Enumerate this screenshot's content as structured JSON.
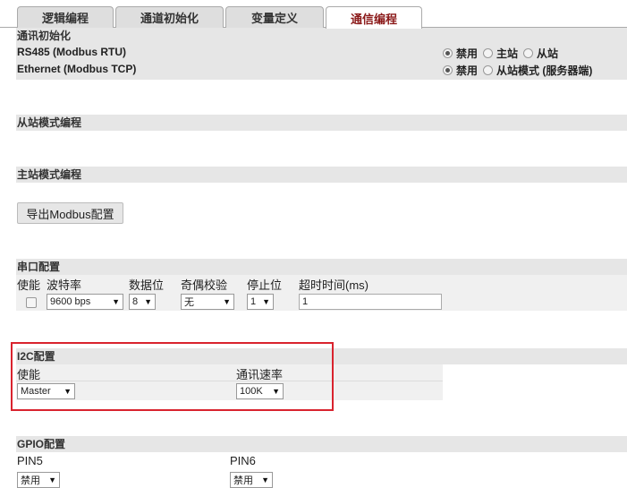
{
  "tabs": [
    {
      "label": "逻辑编程"
    },
    {
      "label": "通道初始化"
    },
    {
      "label": "变量定义"
    },
    {
      "label": "通信编程"
    }
  ],
  "comm_init": {
    "title": "通讯初始化",
    "rs485": {
      "label": "RS485 (Modbus RTU)",
      "options": [
        "禁用",
        "主站",
        "从站"
      ],
      "selected": "禁用"
    },
    "ethernet": {
      "label": "Ethernet (Modbus TCP)",
      "options": [
        "禁用",
        "从站模式 (服务器端)"
      ],
      "selected": "禁用"
    }
  },
  "slave_prog": {
    "title": "从站模式编程"
  },
  "master_prog": {
    "title": "主站模式编程",
    "export_button": "导出Modbus配置"
  },
  "serial": {
    "title": "串口配置",
    "headers": [
      "使能",
      "波特率",
      "数据位",
      "奇偶校验",
      "停止位",
      "超时时间(ms)"
    ],
    "enabled": false,
    "baud": "9600 bps",
    "data_bits": "8",
    "parity": "无",
    "stop_bits": "1",
    "timeout": "1"
  },
  "i2c": {
    "title": "I2C配置",
    "enable_label": "使能",
    "speed_label": "通讯速率",
    "enable_value": "Master",
    "speed_value": "100K"
  },
  "gpio": {
    "title": "GPIO配置",
    "pin5_label": "PIN5",
    "pin6_label": "PIN6",
    "pin5_value": "禁用",
    "pin6_value": "禁用"
  },
  "colors": {
    "active_tab": "#8b1a1a",
    "highlight_box": "#d9232e",
    "section_bg": "#e6e6e6"
  }
}
